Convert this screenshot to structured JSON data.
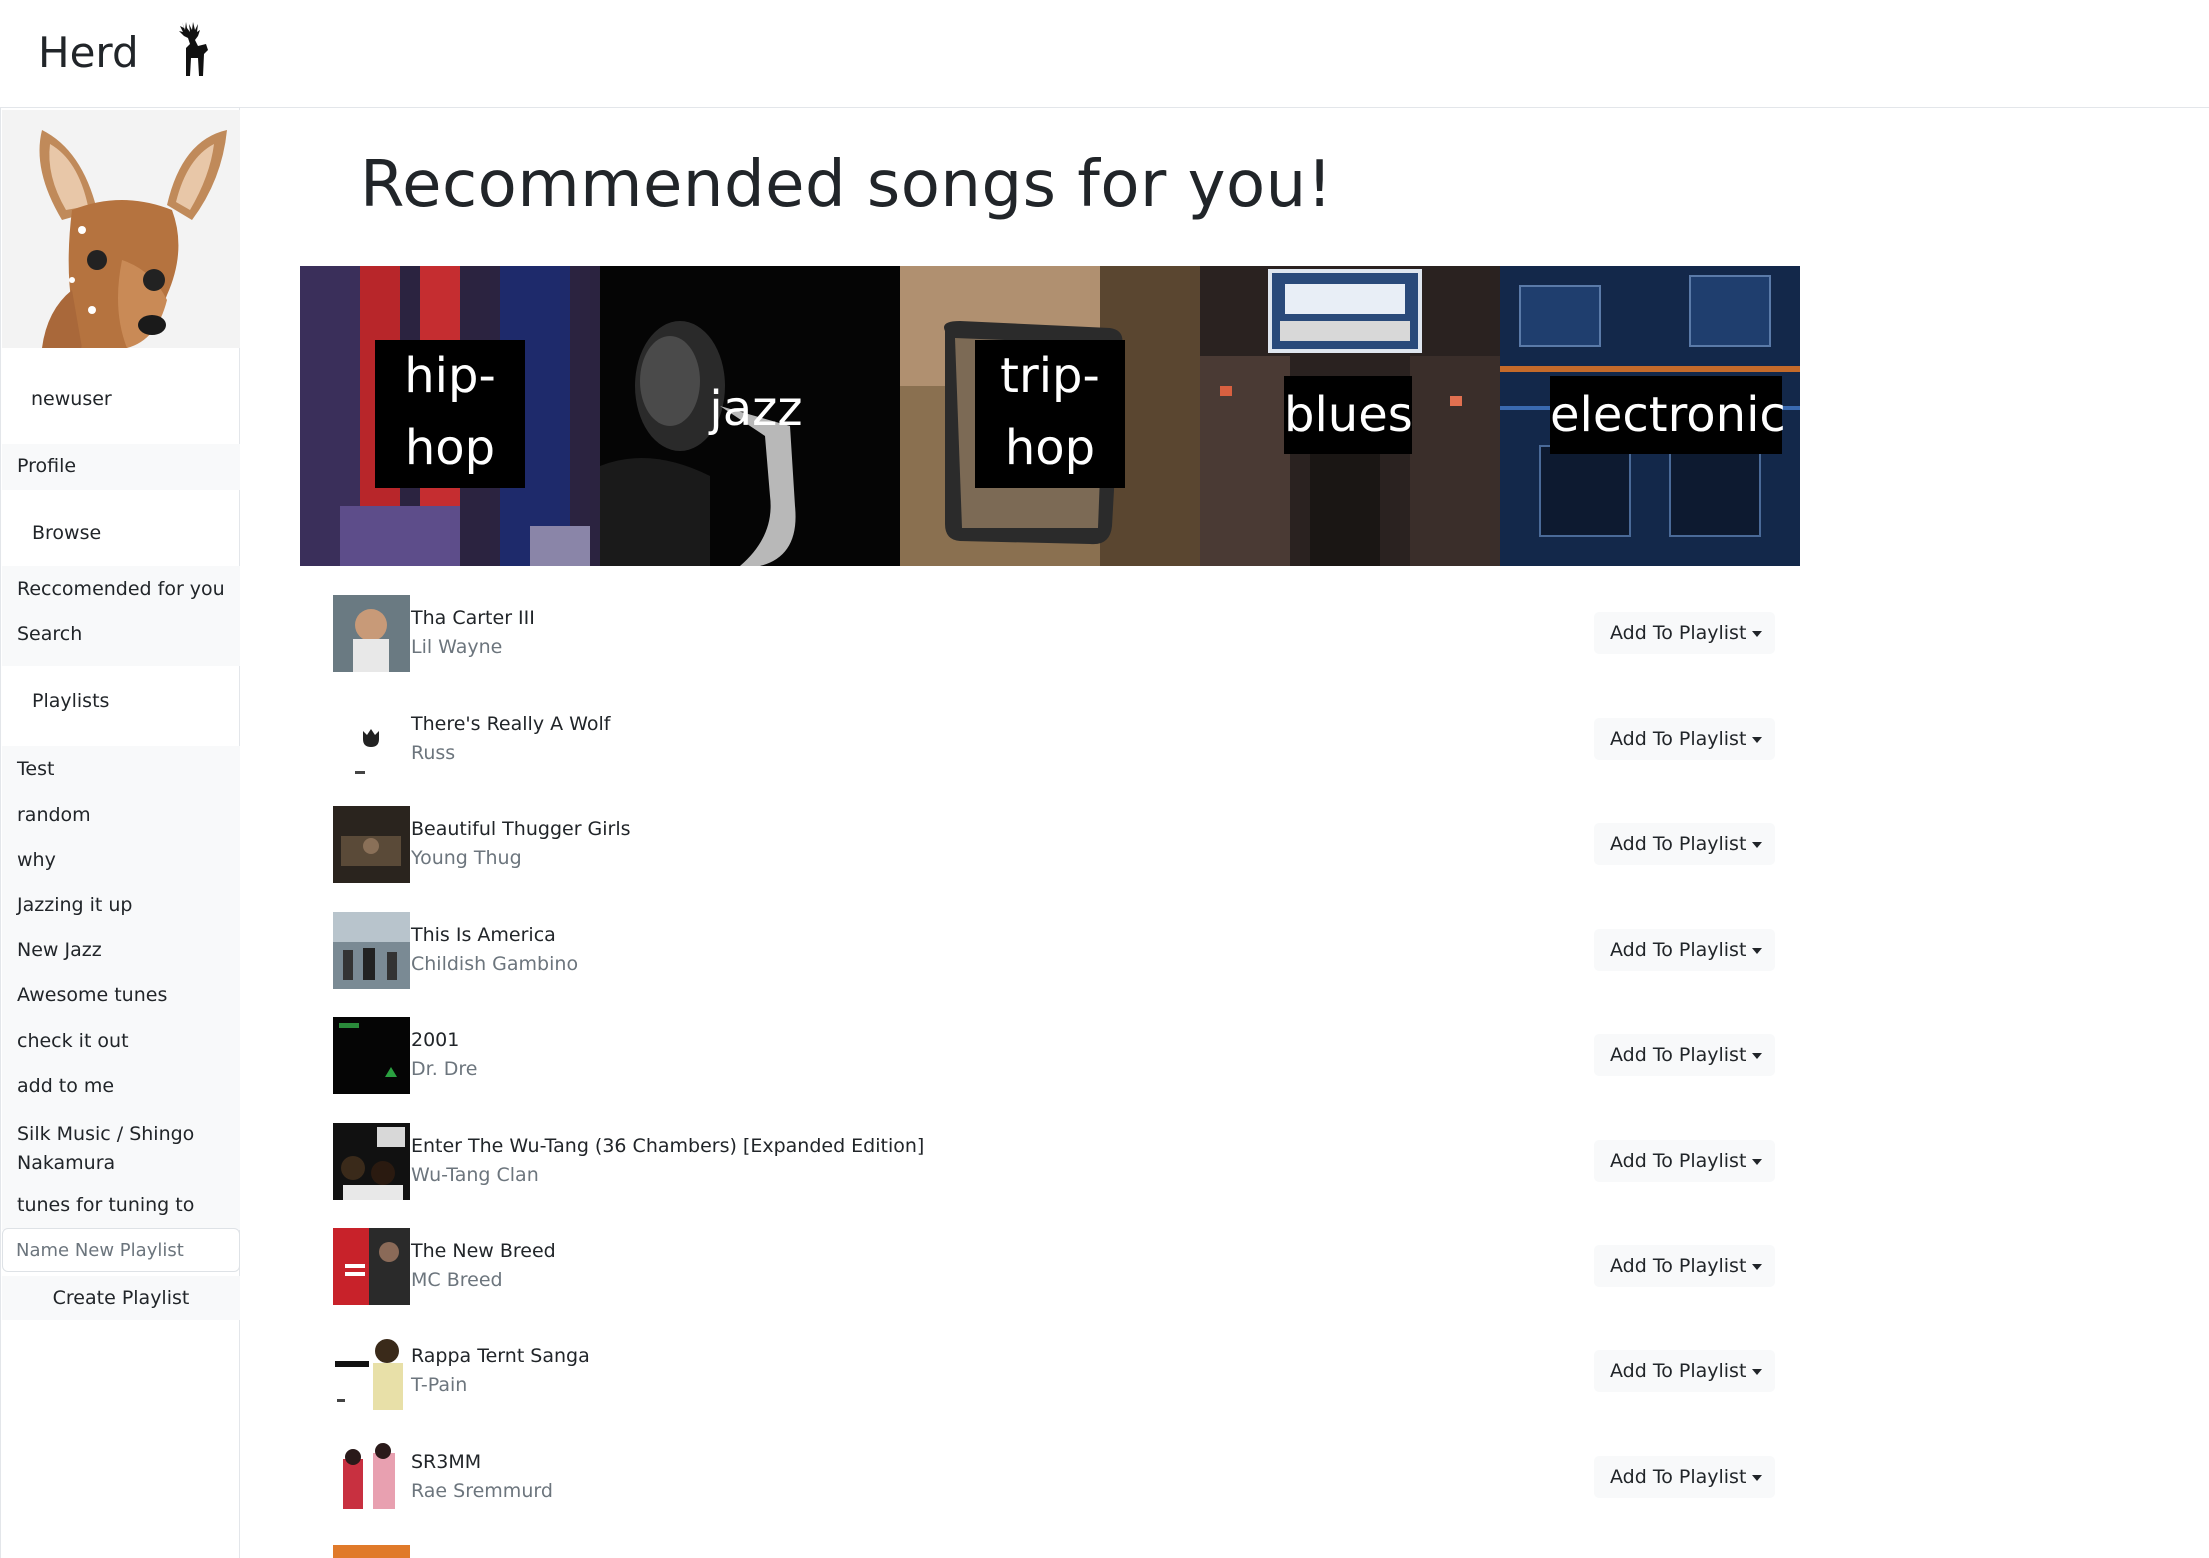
{
  "navbar": {
    "brand": "Herd",
    "brand_icon": "deer-icon"
  },
  "sidebar": {
    "avatar": "fawn-avatar",
    "username": "newuser",
    "profile": "Profile",
    "browse_heading": "Browse",
    "browse_items": [
      "Reccomended for you",
      "Search"
    ],
    "playlists_heading": "Playlists",
    "playlists": [
      "Test",
      "random",
      "why",
      "Jazzing it up",
      "New Jazz",
      "Awesome tunes",
      "check it out",
      "add to me",
      "Silk Music / Shingo Nakamura",
      "tunes for tuning to"
    ],
    "new_playlist_placeholder": "Name New Playlist",
    "create_playlist_label": "Create Playlist"
  },
  "main": {
    "title": "Recommended songs for you!",
    "genres": [
      "hip-hop",
      "jazz",
      "trip-hop",
      "blues",
      "electronic"
    ],
    "add_to_playlist_label": "Add To Playlist",
    "songs": [
      {
        "title": "Tha Carter III",
        "artist": "Lil Wayne"
      },
      {
        "title": "There's Really A Wolf",
        "artist": "Russ"
      },
      {
        "title": "Beautiful Thugger Girls",
        "artist": "Young Thug"
      },
      {
        "title": "This Is America",
        "artist": "Childish Gambino"
      },
      {
        "title": "2001",
        "artist": "Dr. Dre"
      },
      {
        "title": "Enter The Wu-Tang (36 Chambers) [Expanded Edition]",
        "artist": "Wu-Tang Clan"
      },
      {
        "title": "The New Breed",
        "artist": "MC Breed"
      },
      {
        "title": "Rappa Ternt Sanga",
        "artist": "T-Pain"
      },
      {
        "title": "SR3MM",
        "artist": "Rae Sremmurd"
      }
    ]
  },
  "colors": {
    "muted_text": "#6c757d",
    "sidebar_row_bg": "#f8f9fa",
    "label_bg": "#000000"
  }
}
